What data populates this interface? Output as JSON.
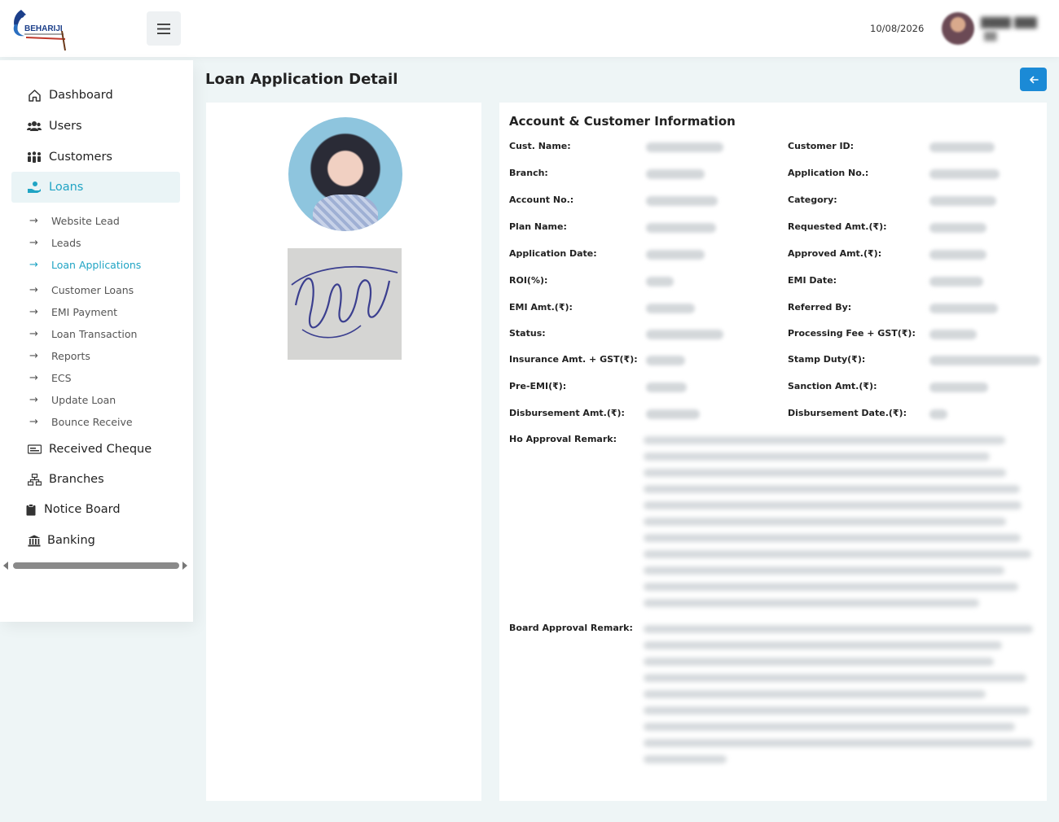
{
  "header": {
    "logo_text": "BEHARIJI",
    "date": "10/08/2026"
  },
  "sidebar": {
    "items": [
      {
        "label": "Dashboard",
        "icon": "home-icon"
      },
      {
        "label": "Users",
        "icon": "users-icon"
      },
      {
        "label": "Customers",
        "icon": "customers-icon"
      },
      {
        "label": "Loans",
        "icon": "hand-money-icon",
        "active": true
      },
      {
        "label": "Received Cheque",
        "icon": "cheque-icon"
      },
      {
        "label": "Branches",
        "icon": "branches-icon"
      },
      {
        "label": "Notice Board",
        "icon": "clipboard-icon"
      },
      {
        "label": "Banking",
        "icon": "bank-icon"
      }
    ],
    "loan_subitems": [
      "Website Lead",
      "Leads",
      "Loan Applications",
      "Customer Loans",
      "EMI Payment",
      "Loan Transaction",
      "Reports",
      "ECS",
      "Update Loan",
      "Bounce Receive"
    ],
    "active_subitem": "Loan Applications"
  },
  "main": {
    "title": "Loan Application Detail",
    "back_icon": "arrow-left-icon",
    "section_title": "Account & Customer Information",
    "fields_left": [
      "Cust. Name:",
      "Branch:",
      "Account No.:",
      "Plan Name:",
      "Application Date:",
      "ROI(%):",
      "EMI Amt.(₹):",
      "Status:",
      "Insurance Amt. + GST(₹):",
      "Pre-EMI(₹):",
      "Disbursement Amt.(₹):"
    ],
    "fields_right": [
      "Customer ID:",
      "Application No.:",
      "Category:",
      "Requested Amt.(₹):",
      "Approved Amt.(₹):",
      "EMI Date:",
      "Referred By:",
      "Processing Fee + GST(₹):",
      "Stamp Duty(₹):",
      "Sanction Amt.(₹):",
      "Disbursement Date.(₹):"
    ],
    "ho_remark_label": "Ho Approval Remark:",
    "board_remark_label": "Board Approval Remark:"
  },
  "colors": {
    "accent": "#20a4c4",
    "button": "#1b8ad6",
    "background": "#eef5f6"
  }
}
